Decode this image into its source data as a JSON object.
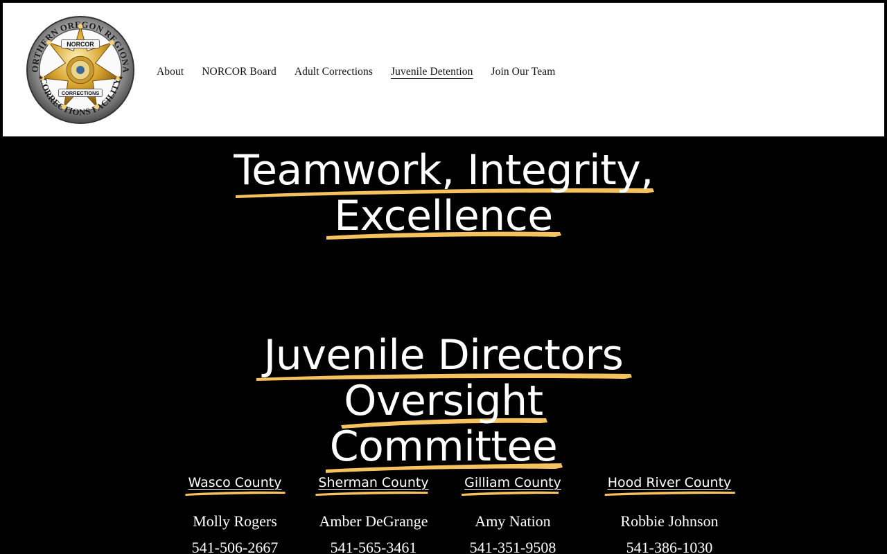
{
  "header": {
    "logo_text": {
      "ring_top": "NORTHERN OREGON REGIONAL",
      "ring_bottom": "CORRECTIONS FACILITY",
      "banner": "NORCOR",
      "center": "CORRECTIONS"
    },
    "nav": [
      {
        "label": "About",
        "active": false
      },
      {
        "label": "NORCOR Board",
        "active": false
      },
      {
        "label": "Adult Corrections",
        "active": false
      },
      {
        "label": "Juvenile Detention",
        "active": true
      },
      {
        "label": "Join Our Team",
        "active": false
      }
    ]
  },
  "hero": {
    "line1": "Teamwork, Integrity,",
    "line2": "Excellence"
  },
  "committee": {
    "line1": "Juvenile Directors",
    "line2": "Oversight",
    "line3": "Committee"
  },
  "counties": [
    {
      "name": "Wasco County",
      "person": "Molly Rogers",
      "phone": "541-506-2667"
    },
    {
      "name": "Sherman County",
      "person": "Amber DeGrange",
      "phone": "541-565-3461"
    },
    {
      "name": "Gilliam County",
      "person": "Amy Nation",
      "phone": "541-351-9508"
    },
    {
      "name": "Hood River County",
      "person": "Robbie Johnson",
      "phone": "541-386-1030"
    }
  ],
  "colors": {
    "accent": "#f6c15f",
    "background": "#000000",
    "header_bg": "#ffffff"
  }
}
